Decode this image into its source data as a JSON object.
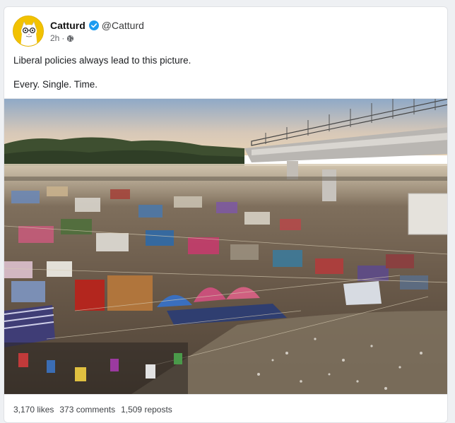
{
  "post": {
    "author_name": "Catturd",
    "author_handle": "@Catturd",
    "time": "2h",
    "separator": "·",
    "line1": "Liberal policies always lead to this picture.",
    "line2": "Every. Single. Time."
  },
  "icons": {
    "verified": "verified-badge-icon",
    "visibility": "globe-icon"
  },
  "colors": {
    "verified_blue": "#1d9bf0",
    "avatar_yellow": "#f2c200"
  },
  "stats": {
    "likes": "3,170 likes",
    "comments": "373 comments",
    "reposts": "1,509 reposts"
  }
}
